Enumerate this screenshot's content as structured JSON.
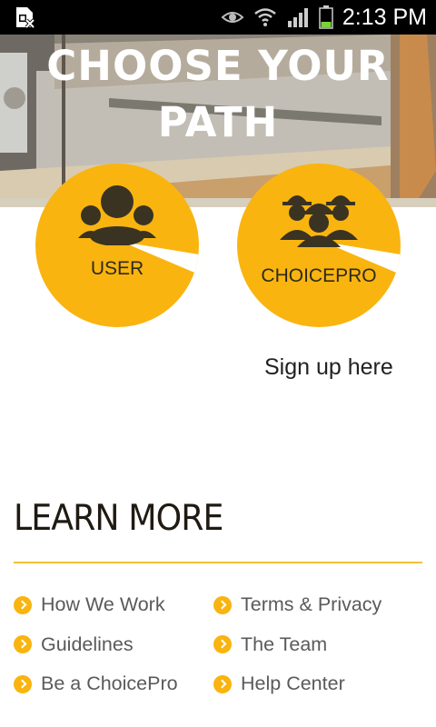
{
  "status_bar": {
    "time": "2:13 PM"
  },
  "hero": {
    "title_line1": "CHOOSE YOUR",
    "title_line2": "PATH"
  },
  "paths": {
    "user_label": "USER",
    "pro_label": "CHOICEPRO"
  },
  "signup_text": "Sign up here",
  "learn_more": {
    "heading": "LEARN MORE",
    "left_links": [
      "How We Work",
      "Guidelines",
      "Be a ChoicePro"
    ],
    "right_links": [
      "Terms & Privacy",
      "The Team",
      "Help Center"
    ]
  },
  "colors": {
    "accent": "#f9b410",
    "icon_dark": "#3a3322",
    "divider": "#f1c232"
  },
  "icons": {
    "status_left": "sim-card-x-icon",
    "status_right": [
      "eye-icon",
      "wifi-icon",
      "signal-icon",
      "battery-icon"
    ],
    "user": "group-icon",
    "pro": "workers-hardhat-icon",
    "bullet": "chevron-circle-icon"
  }
}
